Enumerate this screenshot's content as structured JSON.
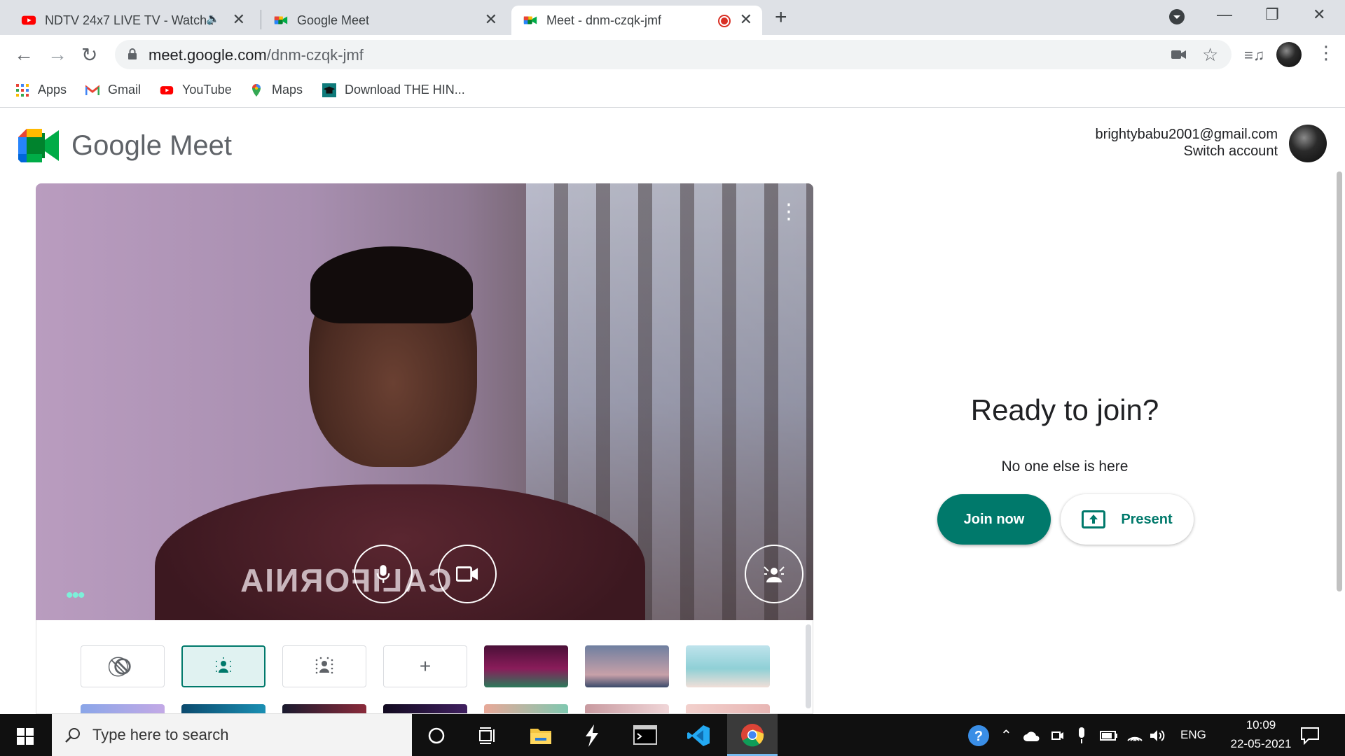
{
  "browser": {
    "tabs": [
      {
        "title": "NDTV 24x7 LIVE TV - Watch L",
        "favicon": "youtube-icon",
        "audio": true
      },
      {
        "title": "Google Meet",
        "favicon": "google-meet-icon"
      },
      {
        "title": "Meet - dnm-czqk-jmf",
        "favicon": "google-meet-icon",
        "recording": true,
        "active": true
      }
    ],
    "url_host": "meet.google.com",
    "url_path": "/dnm-czqk-jmf",
    "bookmarks": [
      {
        "label": "Apps",
        "icon": "apps-grid-icon"
      },
      {
        "label": "Gmail",
        "icon": "gmail-icon"
      },
      {
        "label": "YouTube",
        "icon": "youtube-icon"
      },
      {
        "label": "Maps",
        "icon": "maps-pin-icon"
      },
      {
        "label": "Download THE HIN...",
        "icon": "mortarboard-icon"
      }
    ]
  },
  "meet": {
    "brand": "Google Meet",
    "account_email": "brightybabu2001@gmail.com",
    "switch_account": "Switch account",
    "ready_title": "Ready to join?",
    "status": "No one else is here",
    "join_label": "Join now",
    "present_label": "Present",
    "shirt_text": "CALIFORNIA"
  },
  "colors": {
    "accent": "#00796b",
    "recording": "#d93025"
  },
  "taskbar": {
    "search_placeholder": "Type here to search",
    "language": "ENG",
    "time": "10:09",
    "date": "22-05-2021"
  }
}
